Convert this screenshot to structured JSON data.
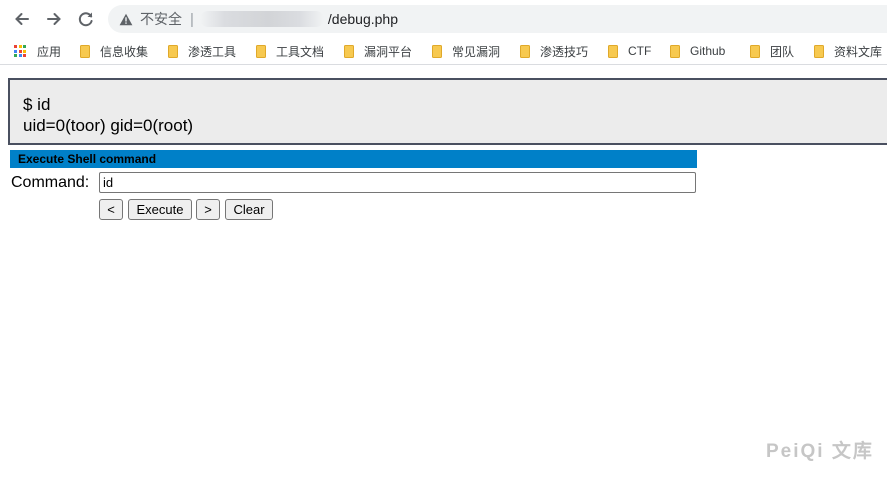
{
  "browser": {
    "security_label": "不安全",
    "separator": "|",
    "url_path": "/debug.php"
  },
  "bookmarks": {
    "apps_label": "应用",
    "items": [
      "信息收集",
      "渗透工具",
      "工具文档",
      "漏洞平台",
      "常见漏洞",
      "渗透技巧",
      "CTF",
      "Github",
      "团队",
      "资料文库"
    ]
  },
  "output": {
    "line1": "$ id",
    "line2": "uid=0(toor) gid=0(root)"
  },
  "panel": {
    "title": "Execute Shell command",
    "command_label": "Command:",
    "command_value": "id",
    "buttons": {
      "prev": "<",
      "execute": "Execute",
      "next": ">",
      "clear": "Clear"
    }
  },
  "watermark": "PeiQi 文库",
  "colors": {
    "panel_header": "#0080c8",
    "folder_icon": "#f7c950",
    "warning_icon": "#5f6368"
  }
}
